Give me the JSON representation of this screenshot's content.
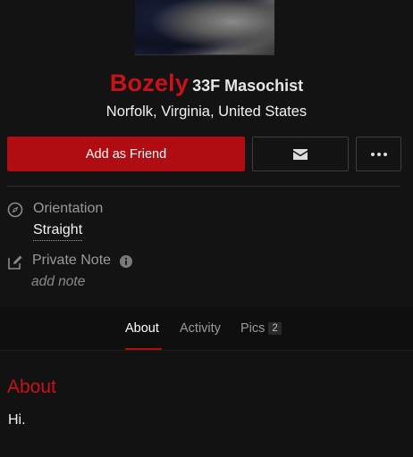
{
  "profile": {
    "username": "Bozely",
    "meta": "33F Masochist",
    "location": "Norfolk, Virginia, United States"
  },
  "actions": {
    "add_friend_label": "Add as Friend",
    "message_icon": "envelope-icon",
    "more_icon": "ellipsis-icon"
  },
  "fields": {
    "orientation_label": "Orientation",
    "orientation_value": "Straight",
    "private_note_label": "Private Note",
    "private_note_placeholder": "add note"
  },
  "tabs": [
    {
      "label": "About",
      "active": true
    },
    {
      "label": "Activity",
      "active": false
    },
    {
      "label": "Pics",
      "active": false,
      "count": "2"
    }
  ],
  "about": {
    "title": "About",
    "body": "Hi."
  },
  "colors": {
    "accent": "#c8121a",
    "button": "#b00d12",
    "background": "#111111"
  }
}
